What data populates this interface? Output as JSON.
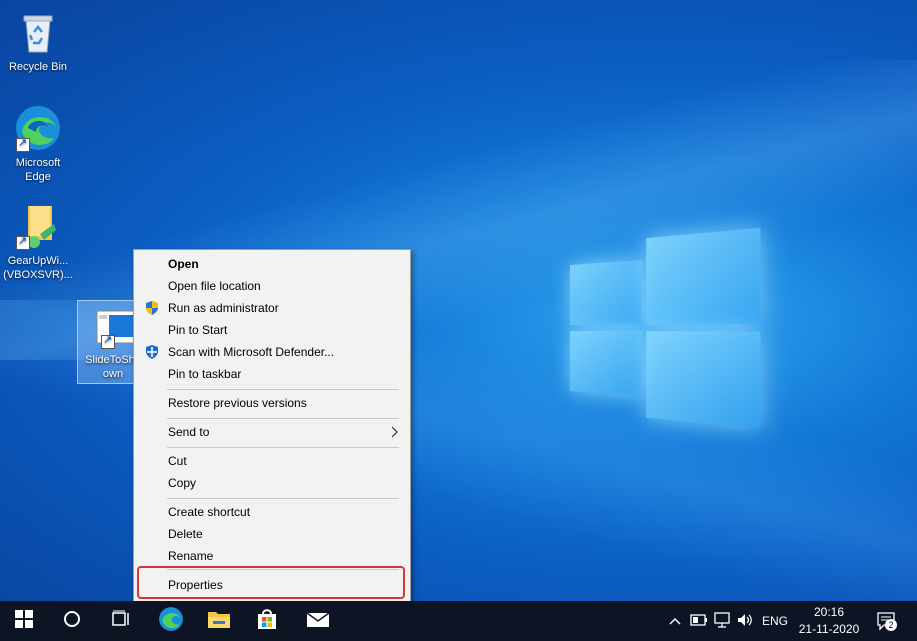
{
  "desktop": {
    "icons": [
      {
        "label": "Recycle Bin",
        "icon": "recycle-bin-icon"
      },
      {
        "label_lines": [
          "Microsoft",
          "Edge"
        ],
        "icon": "edge-icon"
      },
      {
        "label_lines": [
          "GearUpWi...",
          "(VBOXSVR)..."
        ],
        "icon": "folder-icon"
      },
      {
        "label_lines": [
          "SlideToShu",
          "own"
        ],
        "icon": "app-shortcut-icon"
      }
    ]
  },
  "context_menu": {
    "items": [
      {
        "label": "Open"
      },
      {
        "label": "Open file location"
      },
      {
        "label": "Run as administrator",
        "icon": "uac-shield-icon"
      },
      {
        "label": "Pin to Start"
      },
      {
        "label": "Scan with Microsoft Defender...",
        "icon": "defender-icon"
      },
      {
        "label": "Pin to taskbar"
      },
      {
        "label": "Restore previous versions"
      },
      {
        "label": "Send to",
        "icon": "chevron-right-icon"
      },
      {
        "label": "Cut"
      },
      {
        "label": "Copy"
      },
      {
        "label": "Create shortcut"
      },
      {
        "label": "Delete"
      },
      {
        "label": "Rename"
      },
      {
        "label": "Properties"
      }
    ]
  },
  "taskbar": {
    "language": "ENG",
    "time": "20:16",
    "date": "21-11-2020",
    "notification_count": "2"
  },
  "colors": {
    "highlight_box": "#d9343c",
    "taskbar": "#0d1525"
  }
}
